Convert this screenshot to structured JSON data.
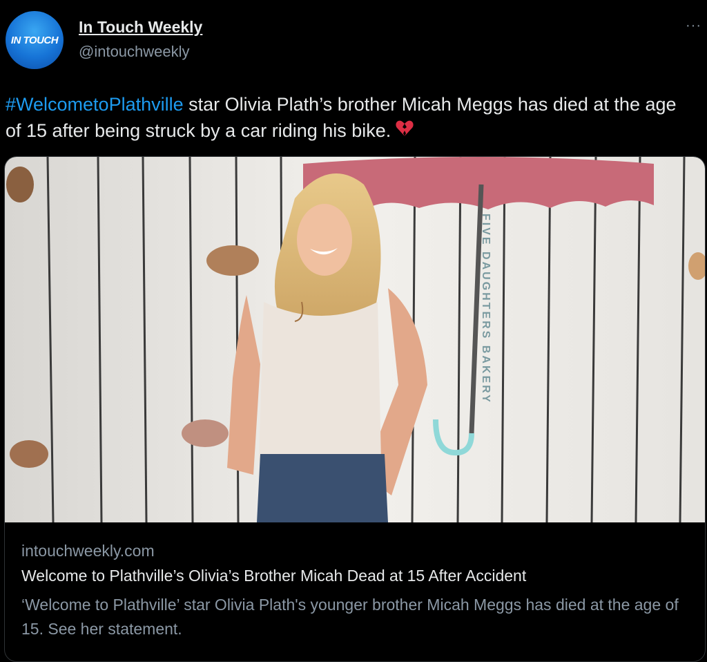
{
  "account": {
    "name": "In Touch Weekly",
    "handle": "@intouchweekly",
    "avatar_text": "IN TOUCH"
  },
  "tweet": {
    "hashtag": "#WelcometoPlathville",
    "text": " star Olivia Plath’s brother Micah Meggs has died at the age of 15 after being struck by a car riding his bike.",
    "emoji": "broken-heart-icon"
  },
  "more_icon": "···",
  "card": {
    "image_sign": "FIVE DAUGHTERS BAKERY",
    "domain": "intouchweekly.com",
    "title": "Welcome to Plathville’s Olivia’s Brother Micah Dead at 15 After Accident",
    "description": "‘Welcome to Plathville’ star Olivia Plath's younger brother Micah Meggs has died at the age of 15. See her statement."
  },
  "colors": {
    "background": "#000000",
    "link": "#1d9bf0",
    "secondary_text": "#8b98a5",
    "primary_text": "#e7e9ea",
    "avatar": "#1673d6"
  }
}
